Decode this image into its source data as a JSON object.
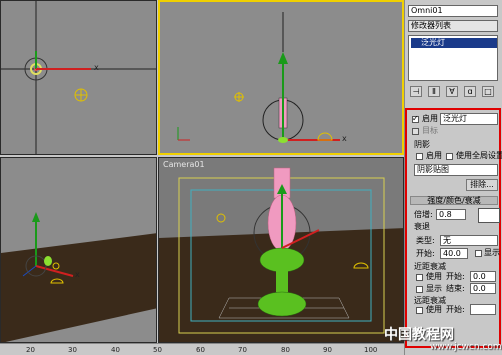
{
  "viewports": {
    "top_left": {
      "axis_label": "x"
    },
    "top_right": {
      "axis_label": "x"
    },
    "bottom_left": {
      "axis_labels": [
        "x"
      ]
    },
    "camera": {
      "label": "Camera01"
    }
  },
  "panel": {
    "object_name": "Omni01",
    "modifier_list": "修改器列表",
    "stack_item": "泛光灯",
    "general": {
      "enable_label": "启用",
      "light_type": "泛光灯",
      "target_label": "目标"
    },
    "shadows": {
      "title": "阴影",
      "enable_label": "启用",
      "global_label": "使用全局设置",
      "shadow_type": "阴影贴图",
      "exclude_button": "排除..."
    },
    "intensity_rollout": "强度/颜色/衰减",
    "multiplier_label": "倍增:",
    "multiplier_value": "0.8",
    "decay": {
      "title": "衰退",
      "type_label": "类型:",
      "type_value": "无",
      "start_label": "开始:",
      "start_value": "40.0",
      "show_label": "显示"
    },
    "near_atten": {
      "title": "近距衰减",
      "use_label": "使用",
      "start_label": "开始:",
      "start_value": "0.0",
      "show_label": "显示",
      "end_label": "结束:",
      "end_value": "0.0"
    },
    "far_atten": {
      "title": "远距衰减",
      "use_label": "使用",
      "start_label": "开始:"
    }
  },
  "timeline": {
    "ticks": [
      "20",
      "30",
      "40",
      "50",
      "60",
      "70",
      "80",
      "90",
      "100"
    ]
  },
  "watermark": {
    "main": "中国教程网",
    "url": "www.jcwcn.com"
  },
  "colors": {
    "highlight": "#e00000",
    "viewport_bg": "#8c8c8c",
    "active_border": "#f0d000"
  }
}
